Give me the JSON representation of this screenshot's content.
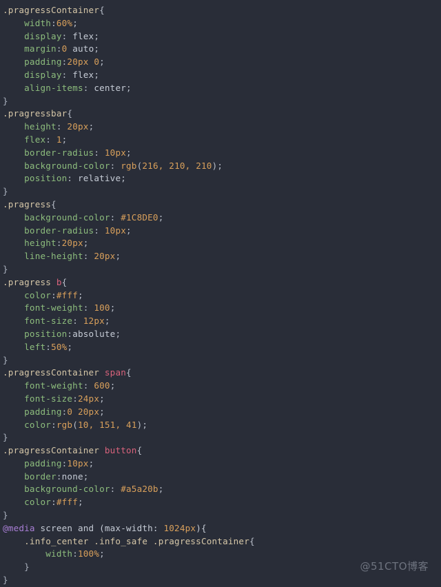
{
  "editor": {
    "background_color": "#292d38",
    "language": "css",
    "font_size_px": 12.6,
    "line_height_px": 18.8
  },
  "palette": {
    "selector": "#d6c7a8",
    "tag_selector": "#d9637c",
    "property": "#8dbd7d",
    "value": "#c6ccd6",
    "number": "#d9a05b",
    "at_rule": "#a97fd6",
    "punctuation": "#b9bfca"
  },
  "watermark": {
    "text": "@51CTO博客"
  },
  "code": {
    "lines": [
      {
        "indent": 0,
        "tokens": [
          {
            "t": "sel",
            "v": ".pragressContainer"
          },
          {
            "t": "punc",
            "v": "{"
          }
        ]
      },
      {
        "indent": 1,
        "tokens": [
          {
            "t": "prop",
            "v": "width"
          },
          {
            "t": "punc",
            "v": ":"
          },
          {
            "t": "num",
            "v": "60%"
          },
          {
            "t": "punc",
            "v": ";"
          }
        ]
      },
      {
        "indent": 1,
        "tokens": [
          {
            "t": "prop",
            "v": "display"
          },
          {
            "t": "punc",
            "v": ": "
          },
          {
            "t": "val",
            "v": "flex"
          },
          {
            "t": "punc",
            "v": ";"
          }
        ]
      },
      {
        "indent": 1,
        "tokens": [
          {
            "t": "prop",
            "v": "margin"
          },
          {
            "t": "punc",
            "v": ":"
          },
          {
            "t": "num",
            "v": "0"
          },
          {
            "t": "val",
            "v": " auto"
          },
          {
            "t": "punc",
            "v": ";"
          }
        ]
      },
      {
        "indent": 1,
        "tokens": [
          {
            "t": "prop",
            "v": "padding"
          },
          {
            "t": "punc",
            "v": ":"
          },
          {
            "t": "num",
            "v": "20px 0"
          },
          {
            "t": "punc",
            "v": ";"
          }
        ]
      },
      {
        "indent": 1,
        "tokens": [
          {
            "t": "prop",
            "v": "display"
          },
          {
            "t": "punc",
            "v": ": "
          },
          {
            "t": "val",
            "v": "flex"
          },
          {
            "t": "punc",
            "v": ";"
          }
        ]
      },
      {
        "indent": 1,
        "tokens": [
          {
            "t": "prop",
            "v": "align-items"
          },
          {
            "t": "punc",
            "v": ": "
          },
          {
            "t": "val",
            "v": "center"
          },
          {
            "t": "punc",
            "v": ";"
          }
        ]
      },
      {
        "indent": 0,
        "tokens": [
          {
            "t": "brace",
            "v": "}"
          }
        ]
      },
      {
        "indent": 0,
        "tokens": [
          {
            "t": "sel",
            "v": ".pragressbar"
          },
          {
            "t": "punc",
            "v": "{"
          }
        ]
      },
      {
        "indent": 1,
        "tokens": [
          {
            "t": "prop",
            "v": "height"
          },
          {
            "t": "punc",
            "v": ": "
          },
          {
            "t": "num",
            "v": "20px"
          },
          {
            "t": "punc",
            "v": ";"
          }
        ]
      },
      {
        "indent": 1,
        "tokens": [
          {
            "t": "prop",
            "v": "flex"
          },
          {
            "t": "punc",
            "v": ": "
          },
          {
            "t": "num",
            "v": "1"
          },
          {
            "t": "punc",
            "v": ";"
          }
        ]
      },
      {
        "indent": 1,
        "tokens": [
          {
            "t": "prop",
            "v": "border-radius"
          },
          {
            "t": "punc",
            "v": ": "
          },
          {
            "t": "num",
            "v": "10px"
          },
          {
            "t": "punc",
            "v": ";"
          }
        ]
      },
      {
        "indent": 1,
        "tokens": [
          {
            "t": "prop",
            "v": "background-color"
          },
          {
            "t": "punc",
            "v": ": "
          },
          {
            "t": "fn",
            "v": "rgb"
          },
          {
            "t": "punc",
            "v": "("
          },
          {
            "t": "num",
            "v": "216, 210, 210"
          },
          {
            "t": "punc",
            "v": ");"
          }
        ]
      },
      {
        "indent": 1,
        "tokens": [
          {
            "t": "prop",
            "v": "position"
          },
          {
            "t": "punc",
            "v": ": "
          },
          {
            "t": "val",
            "v": "relative"
          },
          {
            "t": "punc",
            "v": ";"
          }
        ]
      },
      {
        "indent": 0,
        "tokens": [
          {
            "t": "brace",
            "v": "}"
          }
        ]
      },
      {
        "indent": 0,
        "tokens": [
          {
            "t": "sel",
            "v": ".pragress"
          },
          {
            "t": "punc",
            "v": "{"
          }
        ]
      },
      {
        "indent": 1,
        "tokens": [
          {
            "t": "prop",
            "v": "background-color"
          },
          {
            "t": "punc",
            "v": ": "
          },
          {
            "t": "num",
            "v": "#1C8DE0"
          },
          {
            "t": "punc",
            "v": ";"
          }
        ]
      },
      {
        "indent": 1,
        "tokens": [
          {
            "t": "prop",
            "v": "border-radius"
          },
          {
            "t": "punc",
            "v": ": "
          },
          {
            "t": "num",
            "v": "10px"
          },
          {
            "t": "punc",
            "v": ";"
          }
        ]
      },
      {
        "indent": 1,
        "tokens": [
          {
            "t": "prop",
            "v": "height"
          },
          {
            "t": "punc",
            "v": ":"
          },
          {
            "t": "num",
            "v": "20px"
          },
          {
            "t": "punc",
            "v": ";"
          }
        ]
      },
      {
        "indent": 1,
        "tokens": [
          {
            "t": "prop",
            "v": "line-height"
          },
          {
            "t": "punc",
            "v": ": "
          },
          {
            "t": "num",
            "v": "20px"
          },
          {
            "t": "punc",
            "v": ";"
          }
        ]
      },
      {
        "indent": 0,
        "tokens": [
          {
            "t": "brace",
            "v": "}"
          }
        ]
      },
      {
        "indent": 0,
        "tokens": [
          {
            "t": "sel",
            "v": ".pragress "
          },
          {
            "t": "tag",
            "v": "b"
          },
          {
            "t": "punc",
            "v": "{"
          }
        ]
      },
      {
        "indent": 1,
        "tokens": [
          {
            "t": "prop",
            "v": "color"
          },
          {
            "t": "punc",
            "v": ":"
          },
          {
            "t": "num",
            "v": "#fff"
          },
          {
            "t": "punc",
            "v": ";"
          }
        ]
      },
      {
        "indent": 1,
        "tokens": [
          {
            "t": "prop",
            "v": "font-weight"
          },
          {
            "t": "punc",
            "v": ": "
          },
          {
            "t": "num",
            "v": "100"
          },
          {
            "t": "punc",
            "v": ";"
          }
        ]
      },
      {
        "indent": 1,
        "tokens": [
          {
            "t": "prop",
            "v": "font-size"
          },
          {
            "t": "punc",
            "v": ": "
          },
          {
            "t": "num",
            "v": "12px"
          },
          {
            "t": "punc",
            "v": ";"
          }
        ]
      },
      {
        "indent": 1,
        "tokens": [
          {
            "t": "prop",
            "v": "position"
          },
          {
            "t": "punc",
            "v": ":"
          },
          {
            "t": "val",
            "v": "absolute"
          },
          {
            "t": "punc",
            "v": ";"
          }
        ]
      },
      {
        "indent": 1,
        "tokens": [
          {
            "t": "prop",
            "v": "left"
          },
          {
            "t": "punc",
            "v": ":"
          },
          {
            "t": "num",
            "v": "50%"
          },
          {
            "t": "punc",
            "v": ";"
          }
        ]
      },
      {
        "indent": 0,
        "tokens": [
          {
            "t": "brace",
            "v": "}"
          }
        ]
      },
      {
        "indent": 0,
        "tokens": [
          {
            "t": "sel",
            "v": ".pragressContainer "
          },
          {
            "t": "tag",
            "v": "span"
          },
          {
            "t": "punc",
            "v": "{"
          }
        ]
      },
      {
        "indent": 1,
        "tokens": [
          {
            "t": "prop",
            "v": "font-weight"
          },
          {
            "t": "punc",
            "v": ": "
          },
          {
            "t": "num",
            "v": "600"
          },
          {
            "t": "punc",
            "v": ";"
          }
        ]
      },
      {
        "indent": 1,
        "tokens": [
          {
            "t": "prop",
            "v": "font-size"
          },
          {
            "t": "punc",
            "v": ":"
          },
          {
            "t": "num",
            "v": "24px"
          },
          {
            "t": "punc",
            "v": ";"
          }
        ]
      },
      {
        "indent": 1,
        "tokens": [
          {
            "t": "prop",
            "v": "padding"
          },
          {
            "t": "punc",
            "v": ":"
          },
          {
            "t": "num",
            "v": "0 20px"
          },
          {
            "t": "punc",
            "v": ";"
          }
        ]
      },
      {
        "indent": 1,
        "tokens": [
          {
            "t": "prop",
            "v": "color"
          },
          {
            "t": "punc",
            "v": ":"
          },
          {
            "t": "fn",
            "v": "rgb"
          },
          {
            "t": "punc",
            "v": "("
          },
          {
            "t": "num",
            "v": "10, 151, 41"
          },
          {
            "t": "punc",
            "v": ");"
          }
        ]
      },
      {
        "indent": 0,
        "tokens": [
          {
            "t": "brace",
            "v": "}"
          }
        ]
      },
      {
        "indent": 0,
        "tokens": [
          {
            "t": "sel",
            "v": ".pragressContainer "
          },
          {
            "t": "tag",
            "v": "button"
          },
          {
            "t": "punc",
            "v": "{"
          }
        ]
      },
      {
        "indent": 1,
        "tokens": [
          {
            "t": "prop",
            "v": "padding"
          },
          {
            "t": "punc",
            "v": ":"
          },
          {
            "t": "num",
            "v": "10px"
          },
          {
            "t": "punc",
            "v": ";"
          }
        ]
      },
      {
        "indent": 1,
        "tokens": [
          {
            "t": "prop",
            "v": "border"
          },
          {
            "t": "punc",
            "v": ":"
          },
          {
            "t": "val",
            "v": "none"
          },
          {
            "t": "punc",
            "v": ";"
          }
        ]
      },
      {
        "indent": 1,
        "tokens": [
          {
            "t": "prop",
            "v": "background-color"
          },
          {
            "t": "punc",
            "v": ": "
          },
          {
            "t": "num",
            "v": "#a5a20b"
          },
          {
            "t": "punc",
            "v": ";"
          }
        ]
      },
      {
        "indent": 1,
        "tokens": [
          {
            "t": "prop",
            "v": "color"
          },
          {
            "t": "punc",
            "v": ":"
          },
          {
            "t": "num",
            "v": "#fff"
          },
          {
            "t": "punc",
            "v": ";"
          }
        ]
      },
      {
        "indent": 0,
        "tokens": [
          {
            "t": "brace",
            "v": "}"
          }
        ]
      },
      {
        "indent": 0,
        "tokens": [
          {
            "t": "at",
            "v": "@media"
          },
          {
            "t": "plain",
            "v": " screen and (max-width: "
          },
          {
            "t": "num",
            "v": "1024px"
          },
          {
            "t": "plain",
            "v": "){"
          }
        ]
      },
      {
        "indent": 1,
        "tokens": [
          {
            "t": "sel",
            "v": ".info_center .info_safe .pragressContainer"
          },
          {
            "t": "punc",
            "v": "{"
          }
        ]
      },
      {
        "indent": 2,
        "tokens": [
          {
            "t": "prop",
            "v": "width"
          },
          {
            "t": "punc",
            "v": ":"
          },
          {
            "t": "num",
            "v": "100%"
          },
          {
            "t": "punc",
            "v": ";"
          }
        ]
      },
      {
        "indent": 1,
        "tokens": [
          {
            "t": "brace",
            "v": "}"
          }
        ]
      },
      {
        "indent": 0,
        "tokens": [
          {
            "t": "brace",
            "v": "}"
          }
        ]
      }
    ]
  }
}
